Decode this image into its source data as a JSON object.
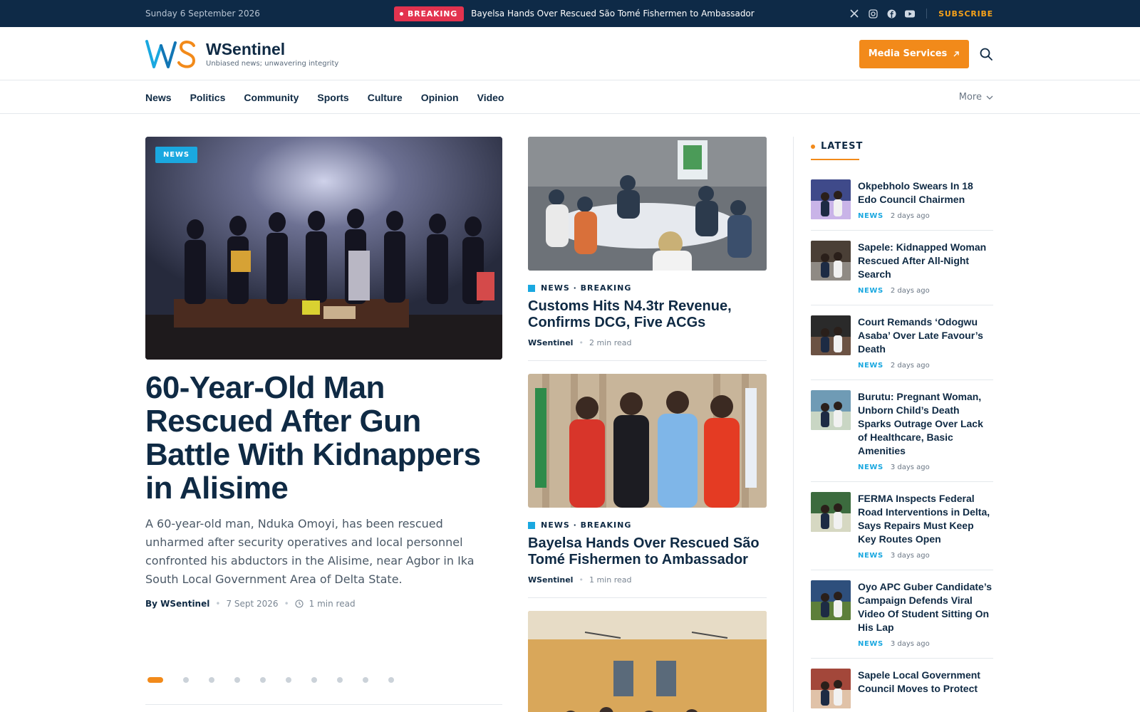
{
  "topbar": {
    "date": "Sunday 6 September 2026",
    "breaking_label": "BREAKING",
    "breaking_headline": "Bayelsa Hands Over Rescued São Tomé Fishermen to Ambassador",
    "social_icons": [
      "x-icon",
      "instagram-icon",
      "facebook-icon",
      "youtube-icon"
    ],
    "subscribe": "SUBSCRIBE"
  },
  "header": {
    "brand_name": "WSentinel",
    "tagline": "Unbiased news; unwavering integrity",
    "media_button": "Media Services"
  },
  "nav": {
    "items": [
      "News",
      "Politics",
      "Community",
      "Sports",
      "Culture",
      "Opinion",
      "Video"
    ],
    "more": "More"
  },
  "lead": {
    "category": "NEWS",
    "title": "60-Year-Old Man Rescued After Gun Battle With Kidnappers in Alisime",
    "excerpt": "A 60-year-old man, Nduka Omoyi, has been rescued unharmed after security operatives and local personnel confronted his abductors in the Alisime, near Agbor in Ika South Local Government Area of Delta State.",
    "author": "By WSentinel",
    "date": "7 Sept 2026",
    "read_time": "1 min read",
    "slide_count": 10,
    "active_slide": 1
  },
  "middle": [
    {
      "category": "NEWS · BREAKING",
      "title": "Customs Hits N4.3tr Revenue, Confirms DCG, Five ACGs",
      "author": "WSentinel",
      "read_time": "2 min read"
    },
    {
      "category": "NEWS · BREAKING",
      "title": "Bayelsa Hands Over Rescued São Tomé Fishermen to Ambassador",
      "author": "WSentinel",
      "read_time": "1 min read"
    }
  ],
  "latest": {
    "heading": "LATEST",
    "items": [
      {
        "title": "Okpebholo Swears In 18 Edo Council Chairmen",
        "category": "NEWS",
        "time": "2 days ago"
      },
      {
        "title": "Sapele: Kidnapped Woman Rescued After All-Night Search",
        "category": "NEWS",
        "time": "2 days ago"
      },
      {
        "title": "Court Remands ‘Odogwu Asaba’ Over Late Favour’s Death",
        "category": "NEWS",
        "time": "2 days ago"
      },
      {
        "title": "Burutu: Pregnant Woman, Unborn Child’s Death Sparks Outrage Over Lack of Healthcare, Basic Amenities",
        "category": "NEWS",
        "time": "3 days ago"
      },
      {
        "title": "FERMA Inspects Federal Road Interventions in Delta, Says Repairs Must Keep Key Routes Open",
        "category": "NEWS",
        "time": "3 days ago"
      },
      {
        "title": "Oyo APC Guber Candidate’s Campaign Defends Viral Video Of Student Sitting On His Lap",
        "category": "NEWS",
        "time": "3 days ago"
      },
      {
        "title": "Sapele Local Government Council Moves to Protect",
        "category": "",
        "time": ""
      }
    ]
  },
  "colors": {
    "navy": "#0e2a47",
    "accent_orange": "#f28a1a",
    "category_blue": "#1aa8e0",
    "breaking_red": "#e3334f"
  }
}
